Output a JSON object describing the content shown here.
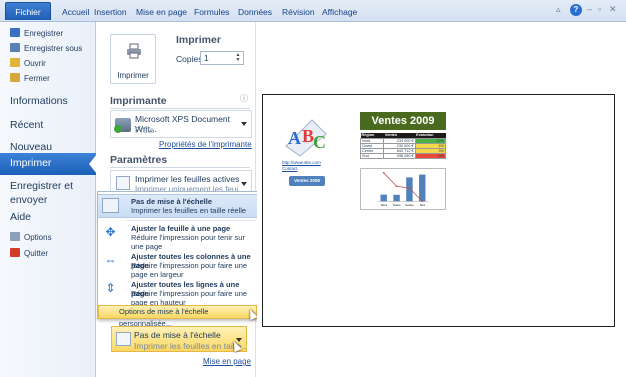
{
  "ribbon": {
    "tabs": [
      "Fichier",
      "Accueil",
      "Insertion",
      "Mise en page",
      "Formules",
      "Données",
      "Révision",
      "Affichage"
    ]
  },
  "nav": {
    "small_items": [
      {
        "label": "Enregistrer",
        "icon": "save-icon",
        "color": "#3a6fc4"
      },
      {
        "label": "Enregistrer sous",
        "icon": "save-as-icon",
        "color": "#5a7fb5"
      },
      {
        "label": "Ouvrir",
        "icon": "open-folder-icon",
        "color": "#e1b33a"
      },
      {
        "label": "Fermer",
        "icon": "close-folder-icon",
        "color": "#d8a93a"
      }
    ],
    "big_items": [
      "Informations",
      "Récent",
      "Nouveau"
    ],
    "active": "Imprimer",
    "after_active": [
      "Enregistrer et envoyer",
      "Aide"
    ],
    "bottom_items": [
      {
        "label": "Options",
        "icon": "options-icon",
        "color": "#8aa0bb"
      },
      {
        "label": "Quitter",
        "icon": "exit-icon",
        "color": "#d23b2a"
      }
    ]
  },
  "print": {
    "title": "Imprimer",
    "button_label": "Imprimer",
    "copies_label": "Copies :",
    "copies_value": "1",
    "printer_section": "Imprimante",
    "printer_name": "Microsoft XPS Document Writ...",
    "printer_status": "Prête",
    "printer_props_link": "Propriétés de l'imprimante",
    "settings_section": "Paramètres",
    "setting1_title": "Imprimer les feuilles actives",
    "setting1_desc": "Imprimer uniquement les feui...",
    "scale_title": "Pas de mise à l'échelle",
    "scale_desc": "Imprimer les feuilles en taille ...",
    "page_setup_link": "Mise en page"
  },
  "menu": {
    "items": [
      {
        "title": "Pas de mise à l'échelle",
        "desc": "Imprimer les feuilles en taille réelle"
      },
      {
        "title": "Ajuster la feuille à une page",
        "desc": "Réduire l'impression pour tenir sur une page"
      },
      {
        "title": "Ajuster toutes les colonnes à une page",
        "desc": "Réduire l'impression pour faire une page en largeur"
      },
      {
        "title": "Ajuster toutes les lignes à une page",
        "desc": "Réduire l'impression pour faire une page en hauteur"
      }
    ],
    "custom_option": "Options de mise à l'échelle personnalisée..."
  },
  "preview": {
    "sheet_title": "Ventes 2009",
    "link_line1": "http://www.site.com",
    "link_line2": "Contact",
    "button_label": "Ventes 2008",
    "table_headers": [
      "Région",
      "Ventes",
      "Evolution"
    ],
    "table_rows": [
      [
        "Nord",
        "234 000 €",
        "12%"
      ],
      [
        "Ouest",
        "230 000 €",
        "4%"
      ],
      [
        "Centre",
        "840 712 €",
        "3%"
      ],
      [
        "Sud",
        "938 260 €",
        "-5%"
      ]
    ],
    "evolution_colors": [
      "#4fb04a",
      "#f2d84a",
      "#f2d84a",
      "#e84a3a"
    ]
  },
  "chart_data": {
    "type": "bar",
    "categories": [
      "Nord",
      "Ouest",
      "Centre",
      "Sud"
    ],
    "values": [
      234,
      230,
      840,
      938
    ],
    "line_values": [
      12,
      4,
      3,
      -5
    ],
    "ylim": [
      0,
      1000
    ]
  }
}
